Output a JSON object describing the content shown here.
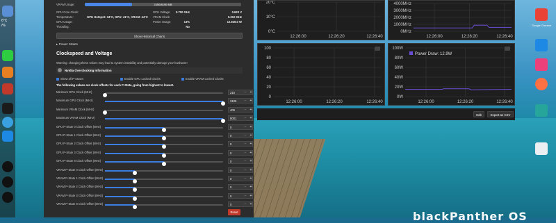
{
  "vram": {
    "label": "VRAM Usage:",
    "text": "2450/8190 MB",
    "fraction": 0.3
  },
  "stats": {
    "gpu_core_clock_label": "GPU Core Clock:",
    "gpu_core_clock": "0.700 GHz",
    "gpu_voltage_label": "GPU Voltage:",
    "gpu_voltage": "0.620 V",
    "temperature_label": "Temperature:",
    "temperature": "GPU Hotspot: 34°C, GPU: 41°C, VRAM: 44°C",
    "vram_clock_label": "VRAM Clock:",
    "vram_clock": "5.010 GHz",
    "gpu_usage_label": "GPU Usage:",
    "gpu_usage": "13%",
    "power_usage_label": "Power Usage:",
    "power_usage": "12.929.0 W",
    "throttling_label": "Throttling:",
    "throttling": "No"
  },
  "buttons": {
    "show_historical": "Show Historical Charts",
    "reset": "Reset",
    "edit": "Edit",
    "export_csv": "Export as CSV"
  },
  "power_states": "▸ Power States",
  "clock_section": {
    "title": "Clockspeed and Voltage",
    "warning": "Warning: changing these values may lead to system instability and potentially damage your hardware!",
    "info": "Nvidia Overclocking Information",
    "checks": [
      "Show all P-States",
      "Enable GPU Locked Clocks",
      "Enable VRAM Locked Clocks"
    ],
    "hint": "The following values are clock offsets for each P-State, going from highest to lowest."
  },
  "sliders": [
    {
      "label": "Minimum GPU Clock (MHz)",
      "value": "210",
      "level": 0.0
    },
    {
      "label": "Maximum GPU Clock (MHz)",
      "value": "3105",
      "level": 1.0
    },
    {
      "label": "Minimum VRAM Clock (MHz)",
      "value": "405",
      "level": 0.0
    },
    {
      "label": "Maximum VRAM Clock (MHz)",
      "value": "8001",
      "level": 1.0
    },
    {
      "label": "GPU P-State 0 Clock Offset (MHz)",
      "value": "0",
      "level": 0.5
    },
    {
      "label": "GPU P-State 1 Clock Offset (MHz)",
      "value": "0",
      "level": 0.5
    },
    {
      "label": "GPU P-State 2 Clock Offset (MHz)",
      "value": "0",
      "level": 0.5
    },
    {
      "label": "GPU P-State 3 Clock Offset (MHz)",
      "value": "0",
      "level": 0.5
    },
    {
      "label": "GPU P-State 8 Clock Offset (MHz)",
      "value": "0",
      "level": 0.5
    },
    {
      "label": "VRAM P-State 0 Clock Offset (MHz)",
      "value": "0",
      "level": 0.25
    },
    {
      "label": "VRAM P-State 1 Clock Offset (MHz)",
      "value": "0",
      "level": 0.25
    },
    {
      "label": "VRAM P-State 2 Clock Offset (MHz)",
      "value": "0",
      "level": 0.25
    },
    {
      "label": "VRAM P-State 3 Clock Offset (MHz)",
      "value": "0",
      "level": 0.25
    },
    {
      "label": "VRAM P-State 8 Clock Offset (MHz)",
      "value": "0",
      "level": 0.25
    }
  ],
  "charts": {
    "temp": {
      "ticks": [
        "20°C",
        "10°C",
        "0°C"
      ],
      "times": [
        "12:26:00",
        "12:26:20",
        "12:26:40"
      ]
    },
    "clock": {
      "ticks": [
        "4000MHz",
        "3000MHz",
        "2000MHz",
        "1000MHz",
        "0MHz"
      ],
      "times": [
        "12:26:00",
        "12:26:20",
        "12:26:40"
      ]
    },
    "usage": {
      "ticks": [
        "100",
        "80",
        "60",
        "40",
        "20",
        "0"
      ],
      "times": [
        "12:26:00",
        "12:26:20",
        "12:26:40"
      ]
    },
    "power": {
      "ticks": [
        "100W",
        "80W",
        "60W",
        "40W",
        "20W",
        "0W"
      ],
      "times": [
        "12:26:00",
        "12:26:20",
        "12:26:40"
      ],
      "legend": "Power Draw: 12.9W",
      "series_color": "#6a4fd6"
    }
  },
  "desktop": {
    "brand": "blackPanther OS",
    "icons": [
      "Google Chrome",
      "",
      "",
      "",
      "Firefox",
      ""
    ]
  },
  "dock": {
    "temp": "6°C",
    "hum": "/%",
    "extra": "3%"
  }
}
